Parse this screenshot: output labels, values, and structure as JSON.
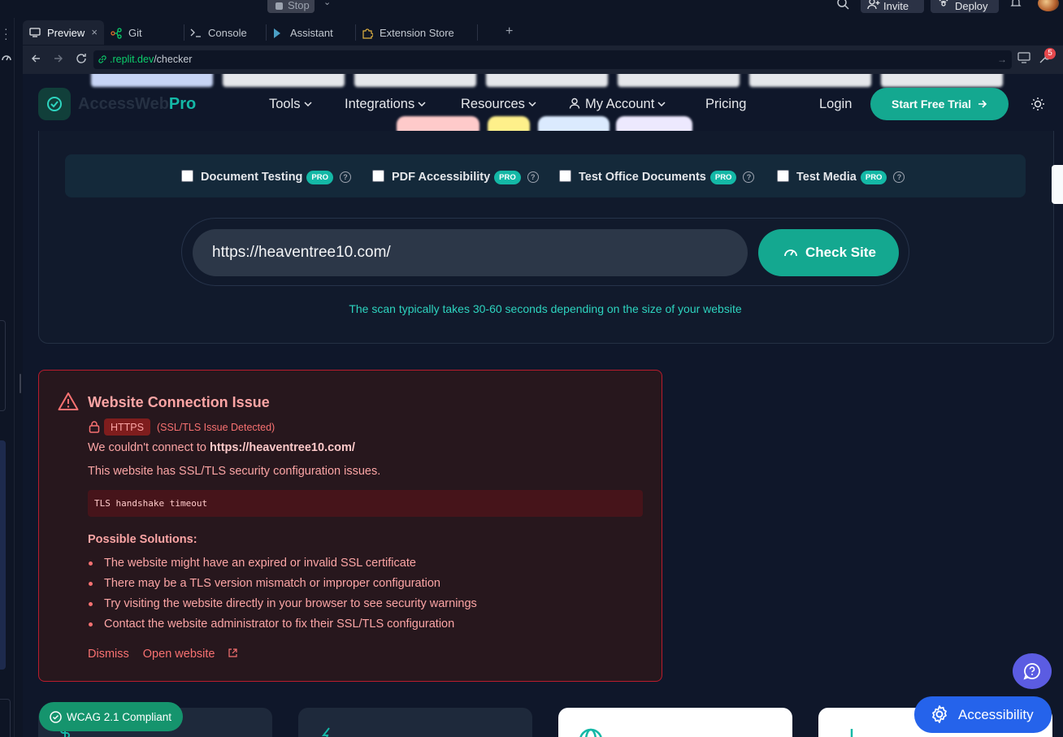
{
  "ide": {
    "stop_label": "Stop",
    "invite_label": "Invite",
    "deploy_label": "Deploy",
    "tabs": [
      {
        "label": "Preview",
        "icon": "monitor-icon"
      },
      {
        "label": "Git",
        "icon": "git-icon"
      },
      {
        "label": "Console",
        "icon": "terminal-icon"
      },
      {
        "label": "Assistant",
        "icon": "assistant-icon"
      },
      {
        "label": "Extension Store",
        "icon": "puzzle-icon"
      }
    ],
    "tab_close": "×",
    "tab_add": "+",
    "url_domain": ".replit.dev",
    "url_path": "/checker",
    "notification_count": "5"
  },
  "site": {
    "brand_main": "AccessWeb",
    "brand_accent": "Pro",
    "nav": [
      {
        "label": "Tools",
        "has_menu": true
      },
      {
        "label": "Integrations",
        "has_menu": true
      },
      {
        "label": "Resources",
        "has_menu": true
      },
      {
        "label": "My Account",
        "has_menu": true
      },
      {
        "label": "Pricing",
        "has_menu": false
      }
    ],
    "login_label": "Login",
    "trial_label": "Start Free Trial",
    "options": [
      {
        "label": "Document Testing",
        "badge": "PRO",
        "checked": false
      },
      {
        "label": "PDF Accessibility",
        "badge": "PRO",
        "checked": false
      },
      {
        "label": "Test Office Documents",
        "badge": "PRO",
        "checked": false
      },
      {
        "label": "Test Media",
        "badge": "PRO",
        "checked": false
      }
    ],
    "url_value": "https://heaventree10.com/",
    "check_label": "Check Site",
    "scan_note": "The scan typically takes 30-60 seconds depending on the size of your website"
  },
  "error": {
    "title": "Website Connection Issue",
    "protocol": "HTTPS",
    "protocol_note": "(SSL/TLS Issue Detected)",
    "connect_prefix": "We couldn't connect to ",
    "connect_url": "https://heaventree10.com/",
    "desc": "This website has SSL/TLS security configuration issues.",
    "code": "TLS handshake timeout",
    "solutions_title": "Possible Solutions:",
    "solutions": [
      "The website might have an expired or invalid SSL certificate",
      "There may be a TLS version mismatch or improper configuration",
      "Try visiting the website directly in your browser to see security warnings",
      "Contact the website administrator to fix their SSL/TLS configuration"
    ],
    "dismiss_label": "Dismiss",
    "open_label": "Open website"
  },
  "widgets": {
    "wcag_label": "WCAG 2.1 Compliant",
    "a11y_label": "Accessibility"
  },
  "colors": {
    "accent": "#14a890",
    "error": "#fca5a5",
    "page_bg": "#0f172a"
  }
}
